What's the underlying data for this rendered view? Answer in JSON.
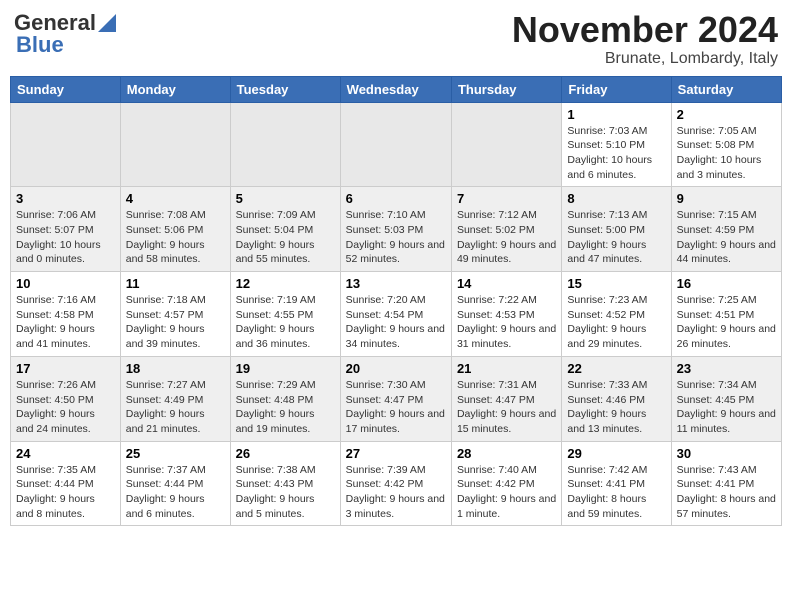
{
  "header": {
    "logo_line1": "General",
    "logo_line2": "Blue",
    "month": "November 2024",
    "location": "Brunate, Lombardy, Italy"
  },
  "weekdays": [
    "Sunday",
    "Monday",
    "Tuesday",
    "Wednesday",
    "Thursday",
    "Friday",
    "Saturday"
  ],
  "weeks": [
    [
      {
        "day": "",
        "info": ""
      },
      {
        "day": "",
        "info": ""
      },
      {
        "day": "",
        "info": ""
      },
      {
        "day": "",
        "info": ""
      },
      {
        "day": "",
        "info": ""
      },
      {
        "day": "1",
        "info": "Sunrise: 7:03 AM\nSunset: 5:10 PM\nDaylight: 10 hours and 6 minutes."
      },
      {
        "day": "2",
        "info": "Sunrise: 7:05 AM\nSunset: 5:08 PM\nDaylight: 10 hours and 3 minutes."
      }
    ],
    [
      {
        "day": "3",
        "info": "Sunrise: 7:06 AM\nSunset: 5:07 PM\nDaylight: 10 hours and 0 minutes."
      },
      {
        "day": "4",
        "info": "Sunrise: 7:08 AM\nSunset: 5:06 PM\nDaylight: 9 hours and 58 minutes."
      },
      {
        "day": "5",
        "info": "Sunrise: 7:09 AM\nSunset: 5:04 PM\nDaylight: 9 hours and 55 minutes."
      },
      {
        "day": "6",
        "info": "Sunrise: 7:10 AM\nSunset: 5:03 PM\nDaylight: 9 hours and 52 minutes."
      },
      {
        "day": "7",
        "info": "Sunrise: 7:12 AM\nSunset: 5:02 PM\nDaylight: 9 hours and 49 minutes."
      },
      {
        "day": "8",
        "info": "Sunrise: 7:13 AM\nSunset: 5:00 PM\nDaylight: 9 hours and 47 minutes."
      },
      {
        "day": "9",
        "info": "Sunrise: 7:15 AM\nSunset: 4:59 PM\nDaylight: 9 hours and 44 minutes."
      }
    ],
    [
      {
        "day": "10",
        "info": "Sunrise: 7:16 AM\nSunset: 4:58 PM\nDaylight: 9 hours and 41 minutes."
      },
      {
        "day": "11",
        "info": "Sunrise: 7:18 AM\nSunset: 4:57 PM\nDaylight: 9 hours and 39 minutes."
      },
      {
        "day": "12",
        "info": "Sunrise: 7:19 AM\nSunset: 4:55 PM\nDaylight: 9 hours and 36 minutes."
      },
      {
        "day": "13",
        "info": "Sunrise: 7:20 AM\nSunset: 4:54 PM\nDaylight: 9 hours and 34 minutes."
      },
      {
        "day": "14",
        "info": "Sunrise: 7:22 AM\nSunset: 4:53 PM\nDaylight: 9 hours and 31 minutes."
      },
      {
        "day": "15",
        "info": "Sunrise: 7:23 AM\nSunset: 4:52 PM\nDaylight: 9 hours and 29 minutes."
      },
      {
        "day": "16",
        "info": "Sunrise: 7:25 AM\nSunset: 4:51 PM\nDaylight: 9 hours and 26 minutes."
      }
    ],
    [
      {
        "day": "17",
        "info": "Sunrise: 7:26 AM\nSunset: 4:50 PM\nDaylight: 9 hours and 24 minutes."
      },
      {
        "day": "18",
        "info": "Sunrise: 7:27 AM\nSunset: 4:49 PM\nDaylight: 9 hours and 21 minutes."
      },
      {
        "day": "19",
        "info": "Sunrise: 7:29 AM\nSunset: 4:48 PM\nDaylight: 9 hours and 19 minutes."
      },
      {
        "day": "20",
        "info": "Sunrise: 7:30 AM\nSunset: 4:47 PM\nDaylight: 9 hours and 17 minutes."
      },
      {
        "day": "21",
        "info": "Sunrise: 7:31 AM\nSunset: 4:47 PM\nDaylight: 9 hours and 15 minutes."
      },
      {
        "day": "22",
        "info": "Sunrise: 7:33 AM\nSunset: 4:46 PM\nDaylight: 9 hours and 13 minutes."
      },
      {
        "day": "23",
        "info": "Sunrise: 7:34 AM\nSunset: 4:45 PM\nDaylight: 9 hours and 11 minutes."
      }
    ],
    [
      {
        "day": "24",
        "info": "Sunrise: 7:35 AM\nSunset: 4:44 PM\nDaylight: 9 hours and 8 minutes."
      },
      {
        "day": "25",
        "info": "Sunrise: 7:37 AM\nSunset: 4:44 PM\nDaylight: 9 hours and 6 minutes."
      },
      {
        "day": "26",
        "info": "Sunrise: 7:38 AM\nSunset: 4:43 PM\nDaylight: 9 hours and 5 minutes."
      },
      {
        "day": "27",
        "info": "Sunrise: 7:39 AM\nSunset: 4:42 PM\nDaylight: 9 hours and 3 minutes."
      },
      {
        "day": "28",
        "info": "Sunrise: 7:40 AM\nSunset: 4:42 PM\nDaylight: 9 hours and 1 minute."
      },
      {
        "day": "29",
        "info": "Sunrise: 7:42 AM\nSunset: 4:41 PM\nDaylight: 8 hours and 59 minutes."
      },
      {
        "day": "30",
        "info": "Sunrise: 7:43 AM\nSunset: 4:41 PM\nDaylight: 8 hours and 57 minutes."
      }
    ]
  ]
}
